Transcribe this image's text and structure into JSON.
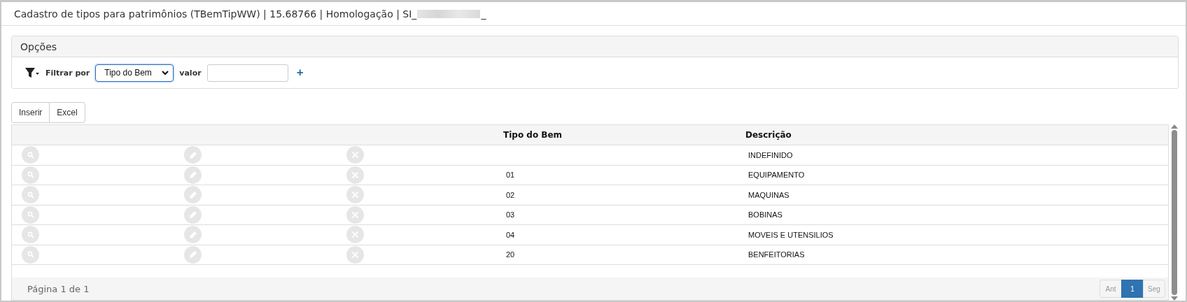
{
  "window": {
    "title": "Cadastro de tipos para patrimônios (TBemTipWW) | 15.68766 | Homologação | SI_",
    "title_suffix": "_"
  },
  "options": {
    "title": "Opções",
    "filter_label": "Filtrar por",
    "filter_select": "Tipo do Bem",
    "value_label": "valor",
    "add": "+"
  },
  "buttons": [
    "Inserir",
    "Excel"
  ],
  "table": {
    "columns": [
      "",
      "",
      "",
      "Tipo do Bem",
      "Descrição"
    ],
    "rows": [
      {
        "code": "",
        "description": "INDEFINIDO"
      },
      {
        "code": "01",
        "description": "EQUIPAMENTO"
      },
      {
        "code": "02",
        "description": "MAQUINAS"
      },
      {
        "code": "03",
        "description": "BOBINAS"
      },
      {
        "code": "04",
        "description": "MOVEIS E UTENSILIOS"
      },
      {
        "code": "20",
        "description": "BENFEITORIAS"
      }
    ]
  },
  "footer": {
    "page_info": "Página 1 de 1",
    "pages": [
      {
        "label": "Ant",
        "selected": false
      },
      {
        "label": "1",
        "selected": true
      },
      {
        "label": "Seg",
        "selected": false
      }
    ]
  }
}
